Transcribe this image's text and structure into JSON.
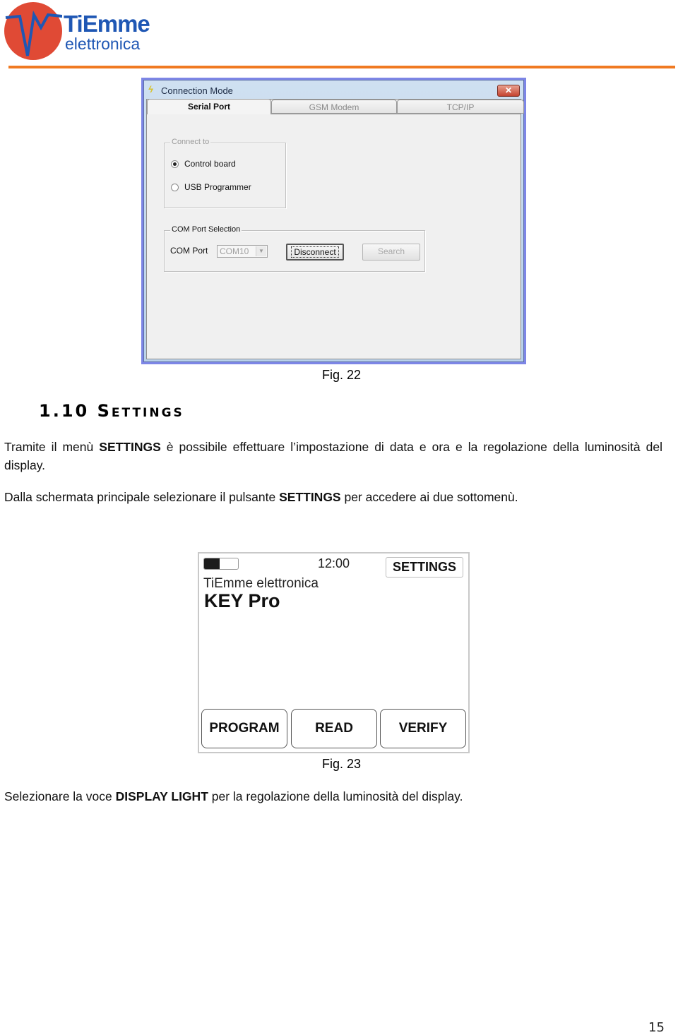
{
  "header": {
    "logo_line1": "TiEmme",
    "logo_line2": "elettronica",
    "colors": {
      "logo_red": "#e04a35",
      "logo_blue": "#1f57b4",
      "rule_orange": "#f07a22"
    }
  },
  "figure22": {
    "window_title": "Connection Mode",
    "title_icon": "lightning-icon",
    "close_glyph": "✕",
    "tabs": [
      {
        "label": "Serial Port",
        "active": true
      },
      {
        "label": "GSM Modem",
        "active": false
      },
      {
        "label": "TCP/IP",
        "active": false
      }
    ],
    "connect_group": {
      "legend": "Connect to",
      "options": [
        {
          "label": "Control board",
          "checked": true
        },
        {
          "label": "USB Programmer",
          "checked": false
        }
      ]
    },
    "com_group": {
      "legend": "COM Port Selection",
      "port_label": "COM Port",
      "port_value": "COM10",
      "dropdown_glyph": "▼",
      "disconnect_label": "Disconnect",
      "search_label": "Search"
    },
    "caption": "Fig. 22"
  },
  "section": {
    "heading": "1.10 Settings"
  },
  "paragraphs": {
    "p1": {
      "before": "Tramite il menù ",
      "bold": "SETTINGS",
      "after": " è possibile effettuare l’impostazione di data e ora e la regolazione della luminosità del display."
    },
    "p2": {
      "before": "Dalla schermata principale selezionare il pulsante ",
      "bold": "SETTINGS",
      "after": " per accedere ai due sottomenù."
    },
    "p3": {
      "before": "Selezionare la voce ",
      "bold": "DISPLAY LIGHT",
      "after": " per la regolazione della luminosità del display."
    }
  },
  "figure23": {
    "battery_level_percent": 45,
    "time": "12:00",
    "settings_label": "SETTINGS",
    "brand": "TiEmme elettronica",
    "product": "KEY Pro",
    "buttons": [
      "PROGRAM",
      "READ",
      "VERIFY"
    ],
    "caption": "Fig. 23"
  },
  "footer": {
    "page_number": "15"
  }
}
